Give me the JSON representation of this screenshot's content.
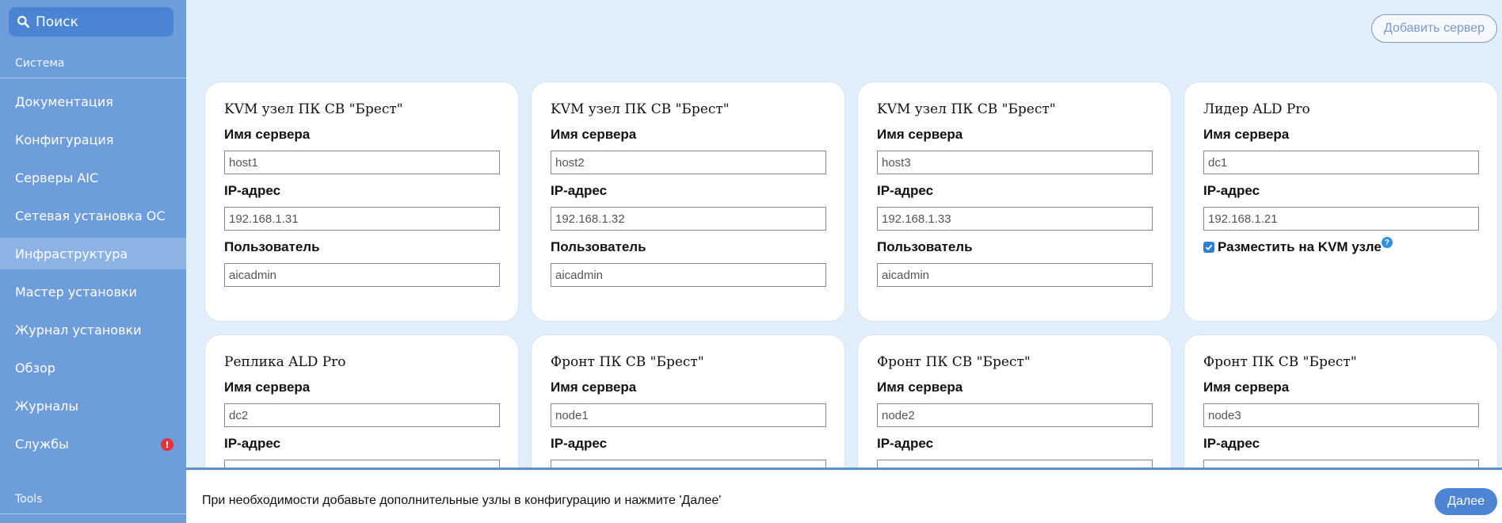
{
  "sidebar": {
    "search_label": "Поиск",
    "section_system": "Система",
    "section_tools": "Tools",
    "items": [
      {
        "label": "Документация"
      },
      {
        "label": "Конфигурация"
      },
      {
        "label": "Серверы AIC"
      },
      {
        "label": "Сетевая установка ОС"
      },
      {
        "label": "Инфраструктура",
        "active": true
      },
      {
        "label": "Мастер установки"
      },
      {
        "label": "Журнал установки"
      },
      {
        "label": "Обзор"
      },
      {
        "label": "Журналы"
      },
      {
        "label": "Службы",
        "badge": "!"
      }
    ]
  },
  "toolbar": {
    "add_server_label": "Добавить сервер"
  },
  "field_labels": {
    "server_name": "Имя сервера",
    "ip": "IP-адрес",
    "user": "Пользователь",
    "place_on_kvm": "Разместить на KVM узле"
  },
  "cards": [
    {
      "title": "KVM узел ПК СВ \"Брест\"",
      "server_name": "host1",
      "ip": "192.168.1.31",
      "user": "aicadmin"
    },
    {
      "title": "KVM узел ПК СВ \"Брест\"",
      "server_name": "host2",
      "ip": "192.168.1.32",
      "user": "aicadmin"
    },
    {
      "title": "KVM узел ПК СВ \"Брест\"",
      "server_name": "host3",
      "ip": "192.168.1.33",
      "user": "aicadmin"
    },
    {
      "title": "Лидер ALD Pro",
      "server_name": "dc1",
      "ip": "192.168.1.21",
      "place_on_kvm": true
    },
    {
      "title": "Реплика ALD Pro",
      "server_name": "dc2"
    },
    {
      "title": "Фронт ПК СВ \"Брест\"",
      "server_name": "node1"
    },
    {
      "title": "Фронт ПК СВ \"Брест\"",
      "server_name": "node2"
    },
    {
      "title": "Фронт ПК СВ \"Брест\"",
      "server_name": "node3"
    }
  ],
  "footer": {
    "message": "При необходимости добавьте дополнительные узлы в конфигурацию и нажмите 'Далее'",
    "next_label": "Далее"
  },
  "colors": {
    "sidebar_bg": "#6e9ddb",
    "sidebar_active": "#8db2e4",
    "main_bg": "#e1eefb",
    "accent": "#4e84d4",
    "badge": "#e2333a"
  }
}
